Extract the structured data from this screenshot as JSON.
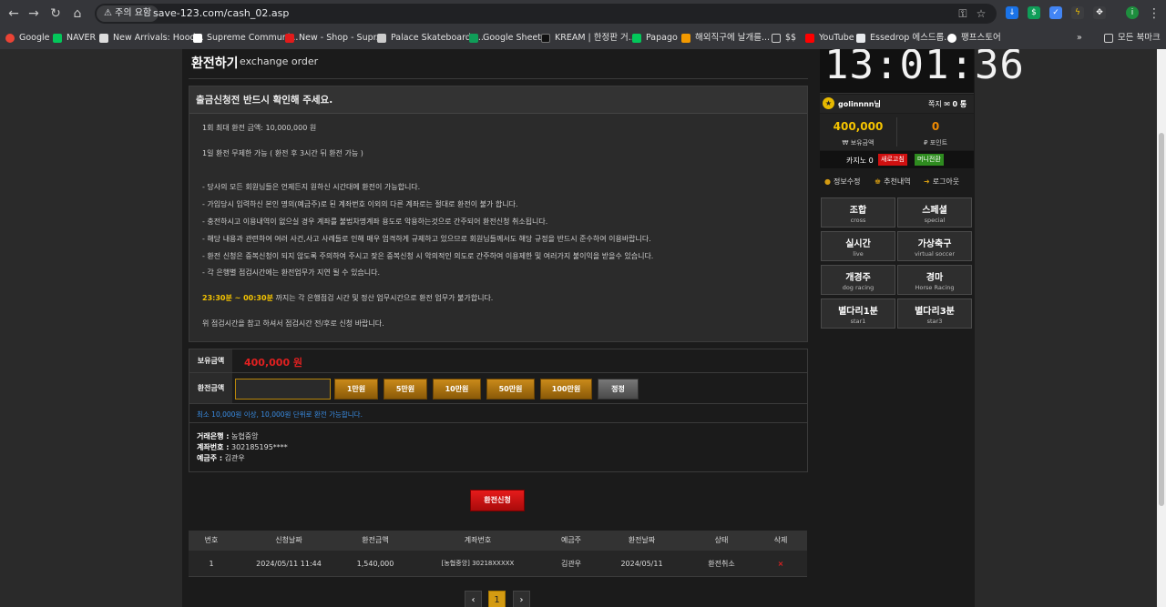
{
  "browser": {
    "warning": "주의 요함",
    "url": "save-123.com/cash_02.asp",
    "bookmarks": [
      "Google",
      "NAVER",
      "New Arrivals: Hood...",
      "Supreme Communi...",
      "New - Shop - Supr...",
      "Palace Skateboards...",
      "Google Sheets",
      "KREAM | 한정판 거...",
      "Papago",
      "해외직구에 날개를...",
      "$$",
      "YouTube",
      "Essedrop 에스드롭...",
      "팽프스토어"
    ],
    "all_bookmarks": "모든 북마크"
  },
  "page": {
    "title": "환전하기",
    "subtitle": "exchange order"
  },
  "notice": {
    "heading": "출금신청전 반드시 확인해 주세요.",
    "lines": [
      "1회 최대 환전 금액: 10,000,000 원",
      "1일 환전 무제한 가능 ( 환전 후 3시간 뒤 환전 가능 )",
      "- 당사의 모든 회원님들은 언제든지 원하신 시간대에 환전이 가능합니다.",
      "- 가입당시 입력하신 본인 명의(예금주)로 된 계좌번호 이외의 다른 계좌로는 절대로 환전이 불가 합니다.",
      "- 충전하시고 이용내역이 없으실 경우 계좌를 불법차명계좌 용도로 악용하는것으로 간주되어 환전신청 취소됩니다.",
      "- 해당 내용과 관련하여 여러 사건,사고 사례들로 인해 매우 엄격하게 규제하고 있으므로 회원님들께서도 해당 규정을 반드시 준수하여 이용바랍니다.",
      "- 환전 신청은 중복신청이 되지 않도록 주의하여 주시고 잦은 중복신청 시 악의적인 의도로 간주하여 이용제한 및 여러가지 불이익을 받을수 있습니다.",
      "- 각 은행별 점검시간에는 환전업무가 지연 될 수 있습니다."
    ],
    "time_highlight": "23:30분 ~ 00:30분",
    "time_text": " 까지는 각 은행점검 시간 및 정산 업무시간으로 환전 업무가 불가합니다.",
    "footer": "위 점검시간을 참고 하셔서 점검시간 전/후로 신청 바랍니다."
  },
  "form": {
    "holding_label": "보유금액",
    "holding_value": "400,000 원",
    "amount_label": "환전금액",
    "amount_value": "",
    "quick": [
      "1만원",
      "5만원",
      "10만원",
      "50만원",
      "100만원"
    ],
    "reset": "정정",
    "min_text": "최소 10,000원 이상, 10,000원 단위로 환전 가능합니다.",
    "bank_label": "거래은행 :",
    "bank": "농협중앙",
    "account_label": "계좌번호 :",
    "account": "302185195****",
    "holder_label": "예금주 :",
    "holder": "김관우",
    "submit": "환전신청"
  },
  "history": {
    "headers": [
      "번호",
      "신청날짜",
      "환전금액",
      "계좌번호",
      "예금주",
      "환전날짜",
      "상태",
      "삭제"
    ],
    "rows": [
      [
        "1",
        "2024/05/11 11:44",
        "1,540,000",
        "[농협중앙] 30218XXXXX",
        "김관우",
        "2024/05/11",
        "환전취소",
        "×"
      ]
    ],
    "page": "1"
  },
  "sidebar": {
    "clock": "13:01:36",
    "username": "golinnnn님",
    "messages_label": "쪽지",
    "messages_count": "0 통",
    "balance": "400,000",
    "balance_label": "보유금액",
    "points": "0",
    "points_label": "포인트",
    "casino_label": "카지노 0",
    "refresh": "새로고침",
    "mini_exchange": "머니전환",
    "links": [
      "정보수정",
      "추천내역",
      "로그아웃"
    ],
    "menu": [
      {
        "ko": "조합",
        "en": "cross"
      },
      {
        "ko": "스페셜",
        "en": "special"
      },
      {
        "ko": "실시간",
        "en": "live"
      },
      {
        "ko": "가상축구",
        "en": "virtual soccer"
      },
      {
        "ko": "개경주",
        "en": "dog racing"
      },
      {
        "ko": "경마",
        "en": "Horse Racing"
      },
      {
        "ko": "별다리1분",
        "en": "star1"
      },
      {
        "ko": "별다리3분",
        "en": "star3"
      }
    ]
  }
}
